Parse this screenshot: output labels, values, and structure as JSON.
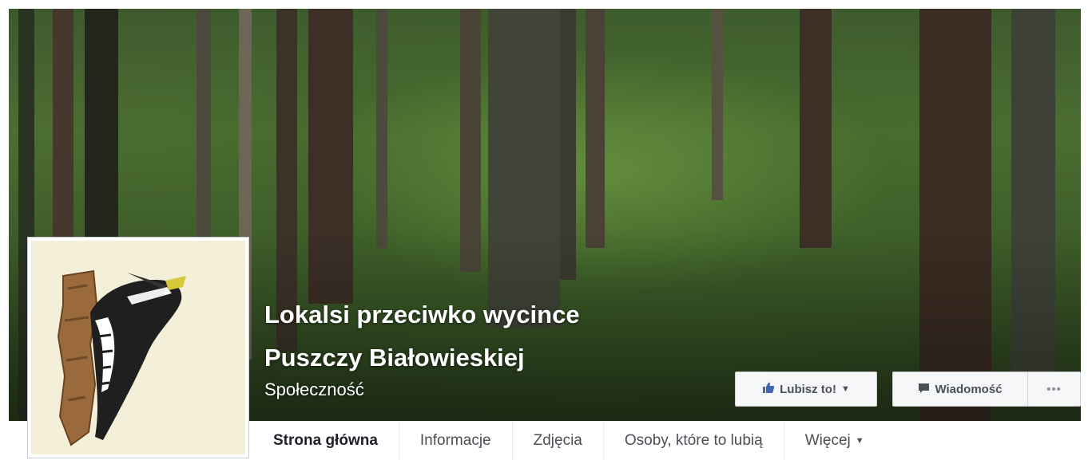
{
  "page": {
    "name_line1": "Lokalsi przeciwko wycince",
    "name_line2": "Puszczy Białowieskiej",
    "category": "Społeczność"
  },
  "actions": {
    "like_label": "Lubisz to!",
    "message_label": "Wiadomość",
    "more_label": "•••"
  },
  "nav": {
    "tabs": [
      {
        "label": "Strona główna"
      },
      {
        "label": "Informacje"
      },
      {
        "label": "Zdjęcia"
      },
      {
        "label": "Osoby, które to lubią"
      },
      {
        "label": "Więcej"
      }
    ],
    "active_tab": "Strona główna"
  },
  "icons": {
    "like": "thumbs-up-icon",
    "like_caret": "caret-down-icon",
    "message": "speech-bubble-icon",
    "more_caret": "caret-down-icon"
  },
  "colors": {
    "button_bg": "#f6f7f9",
    "like_icon": "#4267b2",
    "text_dark": "#1d2129",
    "text_muted": "#4b4f56"
  }
}
